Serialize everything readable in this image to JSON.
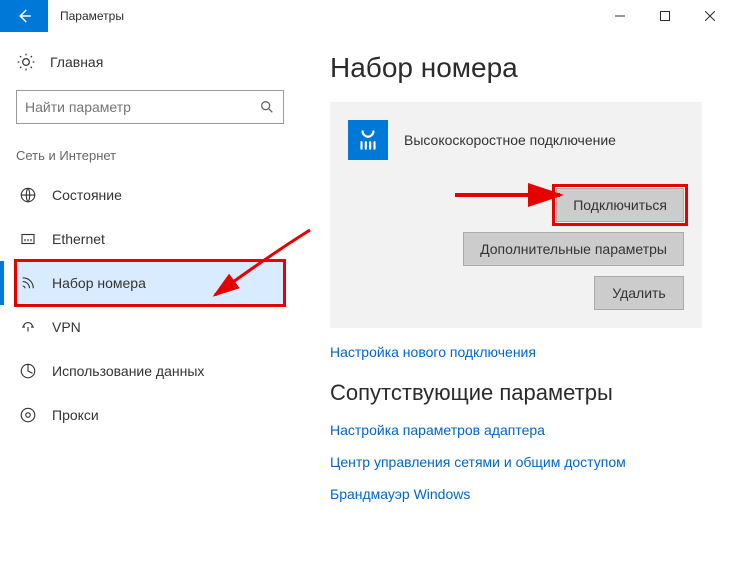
{
  "window": {
    "title": "Параметры"
  },
  "sidebar": {
    "home": "Главная",
    "search_placeholder": "Найти параметр",
    "group": "Сеть и Интернет",
    "items": [
      {
        "label": "Состояние"
      },
      {
        "label": "Ethernet"
      },
      {
        "label": "Набор номера"
      },
      {
        "label": "VPN"
      },
      {
        "label": "Использование данных"
      },
      {
        "label": "Прокси"
      }
    ]
  },
  "main": {
    "title": "Набор номера",
    "connection_name": "Высокоскоростное подключение",
    "btn_connect": "Подключиться",
    "btn_advanced": "Дополнительные параметры",
    "btn_delete": "Удалить",
    "link_new": "Настройка нового подключения",
    "related_title": "Сопутствующие параметры",
    "link_adapter": "Настройка параметров адаптера",
    "link_sharing": "Центр управления сетями и общим доступом",
    "link_firewall": "Брандмауэр Windows"
  }
}
